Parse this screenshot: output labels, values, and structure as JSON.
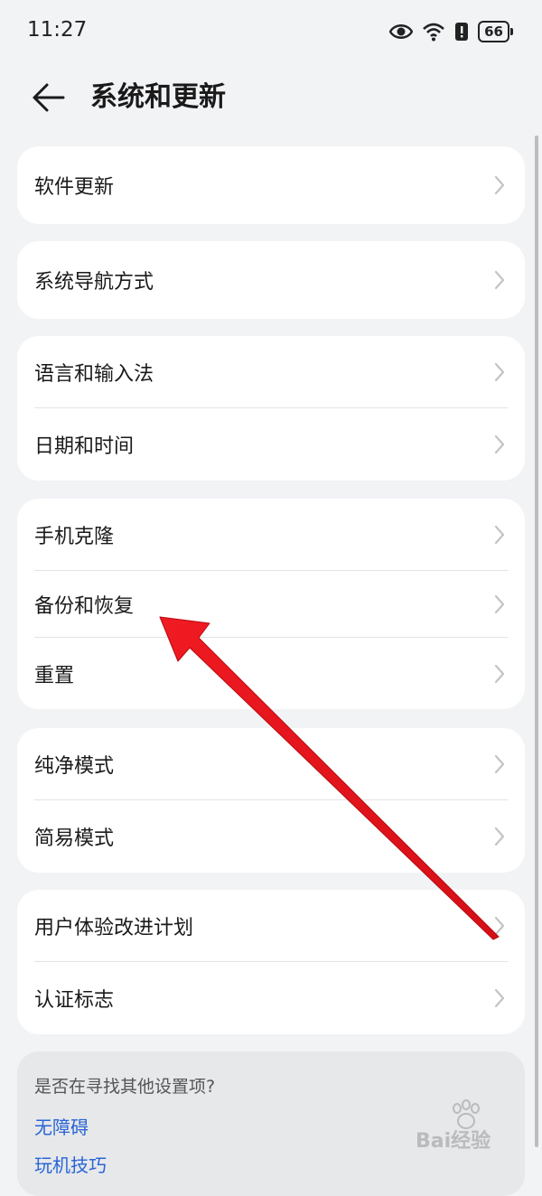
{
  "status_bar": {
    "time": "11:27",
    "battery": "66",
    "icons": [
      "eye-icon",
      "wifi-icon",
      "alert-icon",
      "battery-icon"
    ]
  },
  "header": {
    "back_icon": "arrow-left-icon",
    "title": "系统和更新"
  },
  "groups": [
    {
      "items": [
        {
          "label": "软件更新"
        }
      ]
    },
    {
      "items": [
        {
          "label": "系统导航方式"
        }
      ]
    },
    {
      "items": [
        {
          "label": "语言和输入法"
        },
        {
          "label": "日期和时间"
        }
      ]
    },
    {
      "items": [
        {
          "label": "手机克隆"
        },
        {
          "label": "备份和恢复"
        },
        {
          "label": "重置"
        }
      ]
    },
    {
      "items": [
        {
          "label": "纯净模式"
        },
        {
          "label": "简易模式"
        }
      ]
    },
    {
      "items": [
        {
          "label": "用户体验改进计划"
        },
        {
          "label": "认证标志"
        }
      ]
    }
  ],
  "suggestions": {
    "title": "是否在寻找其他设置项?",
    "links": [
      "无障碍",
      "玩机技巧"
    ]
  },
  "annotation": {
    "color": "#e8141c",
    "points_to": "备份和恢复"
  },
  "watermark": {
    "text": "Bai经验"
  },
  "colors": {
    "background": "#f1f3f5",
    "card": "#ffffff",
    "link": "#2a64d6"
  }
}
